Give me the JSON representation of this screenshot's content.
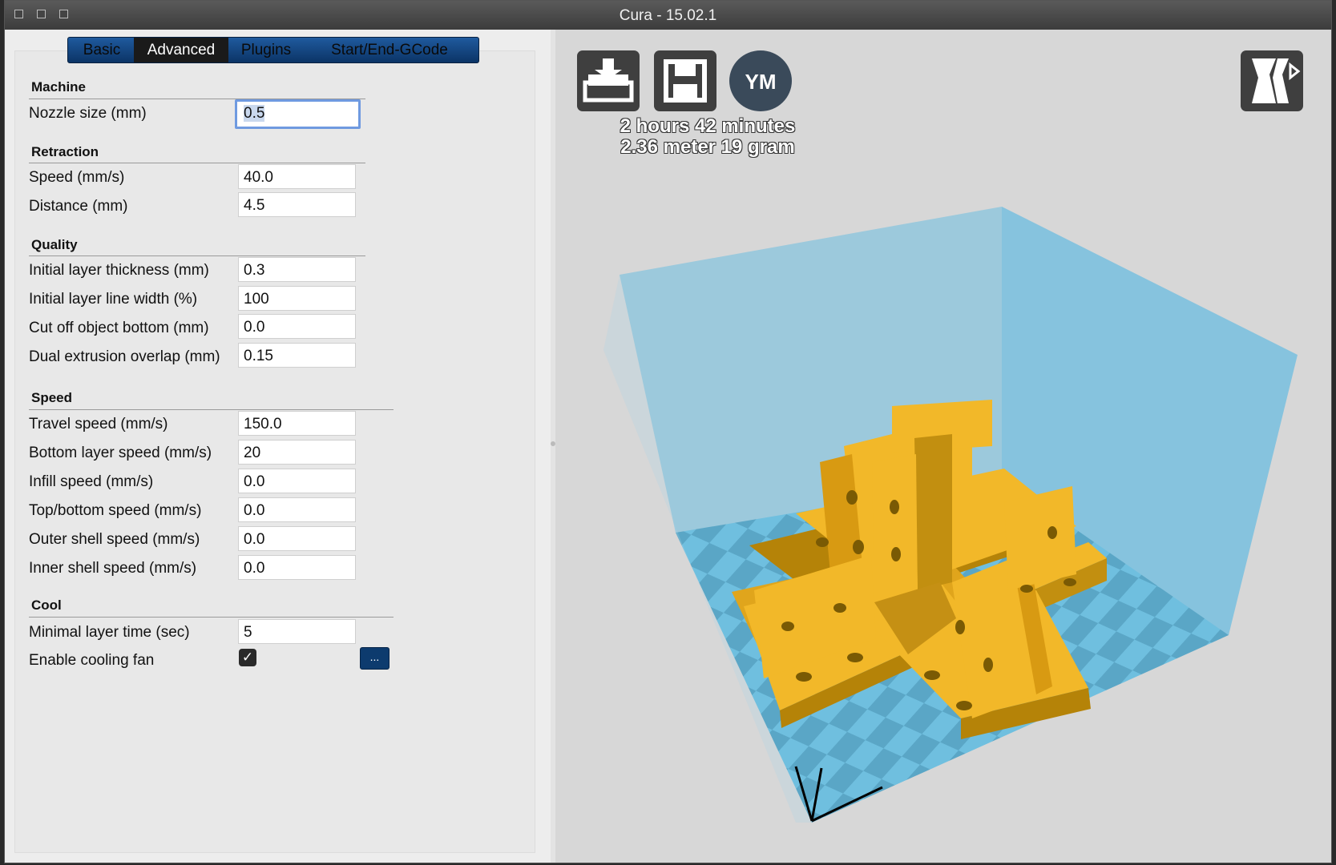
{
  "window": {
    "title": "Cura - 15.02.1"
  },
  "tabs": [
    {
      "label": "Basic"
    },
    {
      "label": "Advanced"
    },
    {
      "label": "Plugins"
    },
    {
      "label": "Start/End-GCode"
    }
  ],
  "sections": {
    "machine": "Machine",
    "retraction": "Retraction",
    "quality": "Quality",
    "speed": "Speed",
    "cool": "Cool"
  },
  "settings": {
    "nozzle_size": {
      "label": "Nozzle size (mm)",
      "value": "0.5"
    },
    "retraction_speed": {
      "label": "Speed (mm/s)",
      "value": "40.0"
    },
    "retraction_distance": {
      "label": "Distance (mm)",
      "value": "4.5"
    },
    "initial_layer_thickness": {
      "label": "Initial layer thickness (mm)",
      "value": "0.3"
    },
    "initial_layer_line_width": {
      "label": "Initial layer line width (%)",
      "value": "100"
    },
    "cut_off_bottom": {
      "label": "Cut off object bottom (mm)",
      "value": "0.0"
    },
    "dual_extrusion_overlap": {
      "label": "Dual extrusion overlap (mm)",
      "value": "0.15"
    },
    "travel_speed": {
      "label": "Travel speed (mm/s)",
      "value": "150.0"
    },
    "bottom_layer_speed": {
      "label": "Bottom layer speed (mm/s)",
      "value": "20"
    },
    "infill_speed": {
      "label": "Infill speed (mm/s)",
      "value": "0.0"
    },
    "top_bottom_speed": {
      "label": "Top/bottom speed (mm/s)",
      "value": "0.0"
    },
    "outer_shell_speed": {
      "label": "Outer shell speed (mm/s)",
      "value": "0.0"
    },
    "inner_shell_speed": {
      "label": "Inner shell speed (mm/s)",
      "value": "0.0"
    },
    "minimal_layer_time": {
      "label": "Minimal layer time (sec)",
      "value": "5"
    },
    "enable_cooling_fan": {
      "label": "Enable cooling fan",
      "checked": true,
      "more_label": "..."
    }
  },
  "viewport": {
    "buttons": {
      "load_icon": "load-icon",
      "save_icon": "save-icon",
      "youmagine_label": "YM",
      "view_mode_icon": "view-mode-icon"
    },
    "print_time": "2 hours 42 minutes",
    "material": "2.36 meter 19 gram"
  },
  "colors": {
    "tab_bar": "#1f5a9e",
    "tab_active": "#1a1a1a",
    "build_volume": "#8cc6df",
    "floor_light": "#6fbfdf",
    "floor_dark": "#5aa6c6",
    "model": "#f2b829",
    "model_shadow": "#b58308"
  }
}
